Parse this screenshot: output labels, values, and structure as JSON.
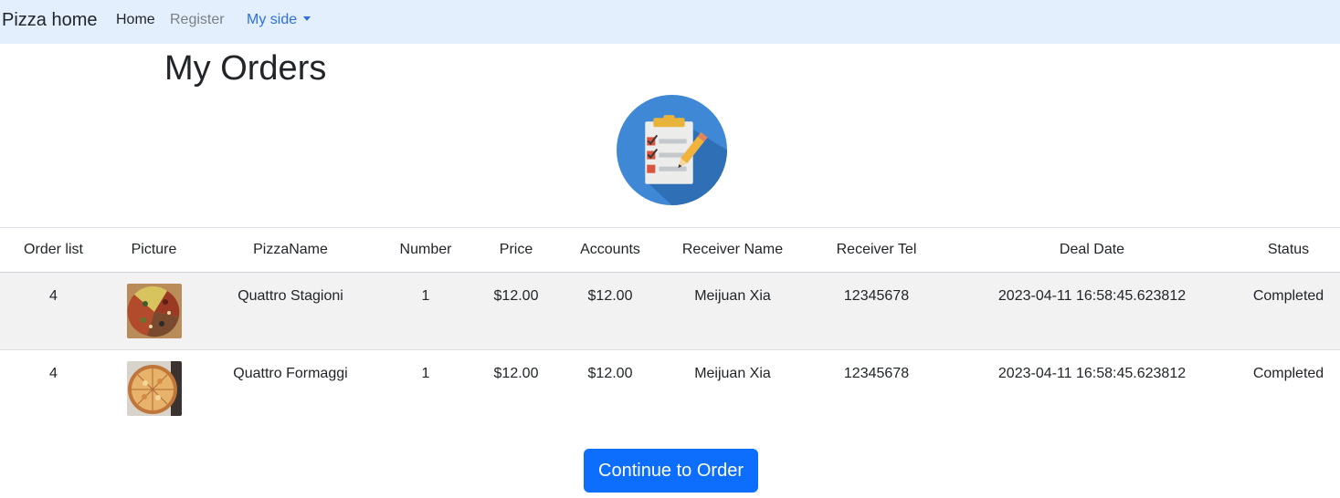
{
  "navbar": {
    "brand": "Pizza home",
    "links": [
      {
        "label": "Home"
      },
      {
        "label": "Register"
      },
      {
        "label": "My side"
      }
    ]
  },
  "page": {
    "title": "My Orders"
  },
  "icons": {
    "orders": "clipboard-checklist-icon"
  },
  "table": {
    "headers": [
      "Order list",
      "Picture",
      "PizzaName",
      "Number",
      "Price",
      "Accounts",
      "Receiver Name",
      "Receiver Tel",
      "Deal Date",
      "Status"
    ],
    "rows": [
      {
        "order": "4",
        "picture": "pizza-quattro-stagioni-photo",
        "name": "Quattro Stagioni",
        "number": "1",
        "price": "$12.00",
        "accounts": "$12.00",
        "receiver_name": "Meijuan Xia",
        "receiver_tel": "12345678",
        "deal_date": "2023-04-11 16:58:45.623812",
        "status": "Completed"
      },
      {
        "order": "4",
        "picture": "pizza-quattro-formaggi-photo",
        "name": "Quattro Formaggi",
        "number": "1",
        "price": "$12.00",
        "accounts": "$12.00",
        "receiver_name": "Meijuan Xia",
        "receiver_tel": "12345678",
        "deal_date": "2023-04-11 16:58:45.623812",
        "status": "Completed"
      }
    ]
  },
  "actions": {
    "continue_label": "Continue to Order"
  },
  "colors": {
    "navbar_bg": "#e3effc",
    "link_active": "#2f6fde",
    "primary_button": "#0d6efd",
    "stripe": "#f2f2f2"
  }
}
